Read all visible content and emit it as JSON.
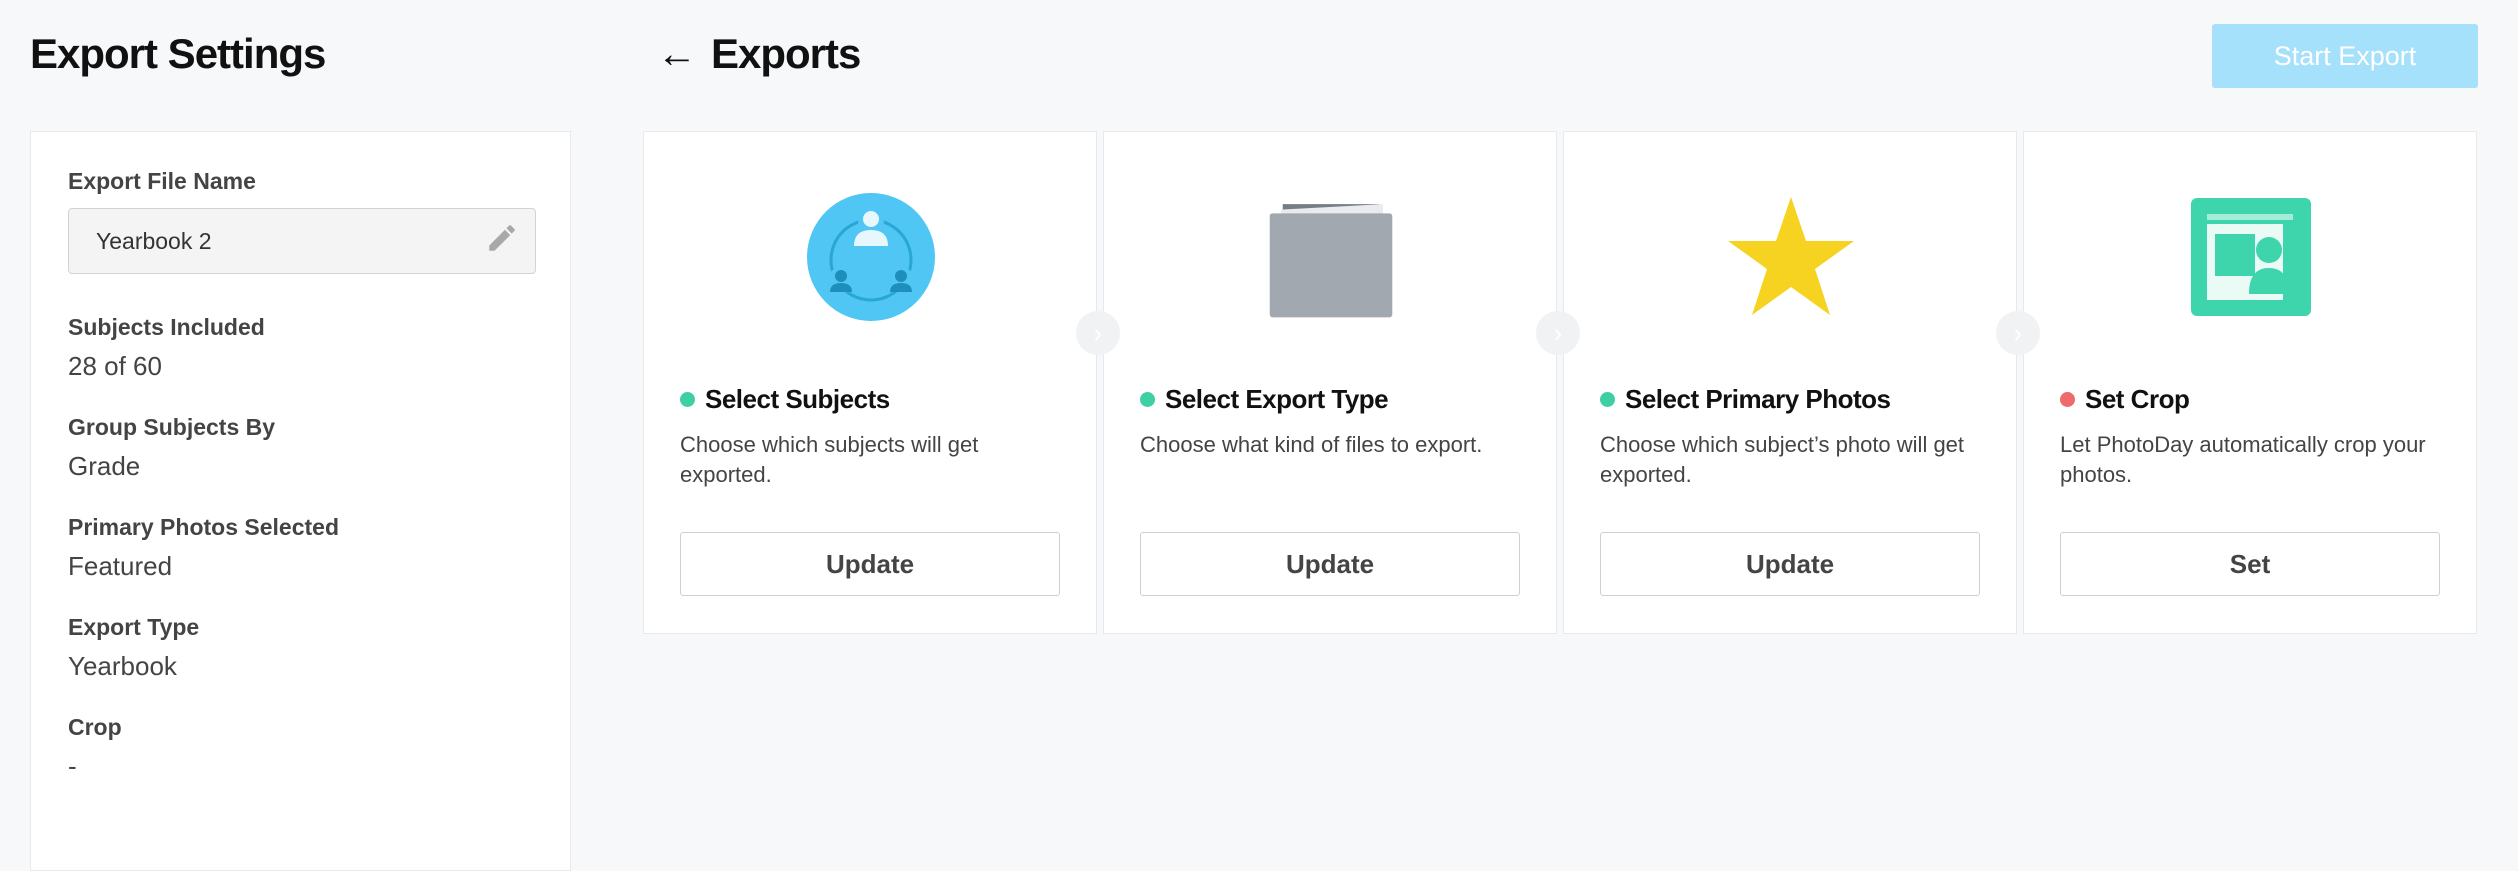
{
  "sidebar": {
    "title": "Export Settings",
    "file_name_label": "Export File Name",
    "file_name_value": "Yearbook 2",
    "info": [
      {
        "label": "Subjects Included",
        "value": "28 of 60"
      },
      {
        "label": "Group Subjects By",
        "value": "Grade"
      },
      {
        "label": "Primary Photos Selected",
        "value": "Featured"
      },
      {
        "label": "Export Type",
        "value": "Yearbook"
      },
      {
        "label": "Crop",
        "value": "-"
      }
    ]
  },
  "header": {
    "back_arrow": "←",
    "title": "Exports",
    "start_button": "Start Export"
  },
  "steps": [
    {
      "icon": "subjects-group-icon",
      "status_color": "#3ecfa5",
      "title": "Select Subjects",
      "description": "Choose which subjects will get exported.",
      "button": "Update"
    },
    {
      "icon": "folder-icon",
      "status_color": "#3ecfa5",
      "title": "Select Export Type",
      "description": "Choose what kind of files to export.",
      "button": "Update"
    },
    {
      "icon": "star-icon",
      "status_color": "#3ecfa5",
      "title": "Select Primary Photos",
      "description": "Choose which subject’s photo will get exported.",
      "button": "Update"
    },
    {
      "icon": "crop-photo-icon",
      "status_color": "#ef6a6a",
      "title": "Set Crop",
      "description": "Let PhotoDay automatically crop your photos.",
      "button": "Set"
    }
  ],
  "colors": {
    "accent_disabled": "#a6e1fb",
    "complete": "#3ecfa5",
    "incomplete": "#ef6a6a",
    "subjects_icon": "#4fc6f4",
    "folder_icon": "#a2a8af",
    "star_icon": "#f5d320",
    "crop_icon": "#3ed5ad"
  }
}
